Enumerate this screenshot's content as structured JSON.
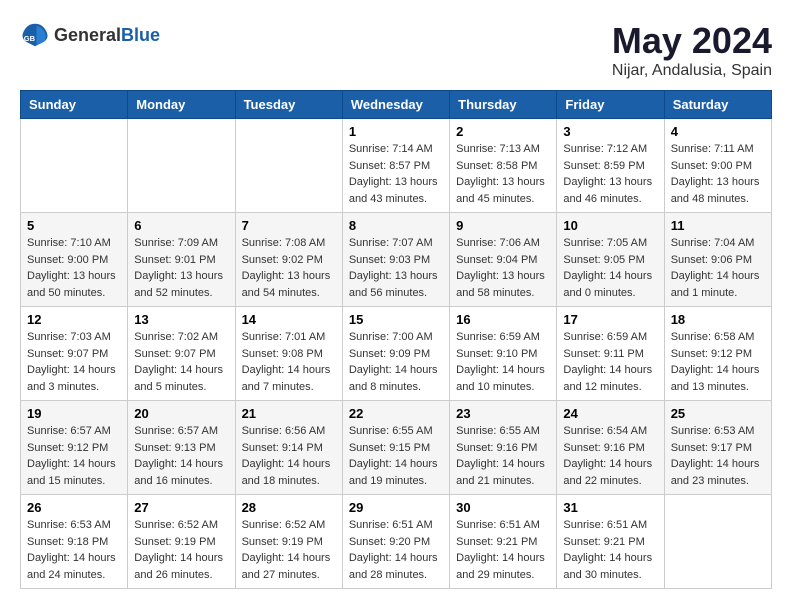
{
  "header": {
    "logo_general": "General",
    "logo_blue": "Blue",
    "month": "May 2024",
    "location": "Nijar, Andalusia, Spain"
  },
  "weekdays": [
    "Sunday",
    "Monday",
    "Tuesday",
    "Wednesday",
    "Thursday",
    "Friday",
    "Saturday"
  ],
  "weeks": [
    [
      {
        "day": "",
        "sunrise": "",
        "sunset": "",
        "daylight": ""
      },
      {
        "day": "",
        "sunrise": "",
        "sunset": "",
        "daylight": ""
      },
      {
        "day": "",
        "sunrise": "",
        "sunset": "",
        "daylight": ""
      },
      {
        "day": "1",
        "sunrise": "Sunrise: 7:14 AM",
        "sunset": "Sunset: 8:57 PM",
        "daylight": "Daylight: 13 hours and 43 minutes."
      },
      {
        "day": "2",
        "sunrise": "Sunrise: 7:13 AM",
        "sunset": "Sunset: 8:58 PM",
        "daylight": "Daylight: 13 hours and 45 minutes."
      },
      {
        "day": "3",
        "sunrise": "Sunrise: 7:12 AM",
        "sunset": "Sunset: 8:59 PM",
        "daylight": "Daylight: 13 hours and 46 minutes."
      },
      {
        "day": "4",
        "sunrise": "Sunrise: 7:11 AM",
        "sunset": "Sunset: 9:00 PM",
        "daylight": "Daylight: 13 hours and 48 minutes."
      }
    ],
    [
      {
        "day": "5",
        "sunrise": "Sunrise: 7:10 AM",
        "sunset": "Sunset: 9:00 PM",
        "daylight": "Daylight: 13 hours and 50 minutes."
      },
      {
        "day": "6",
        "sunrise": "Sunrise: 7:09 AM",
        "sunset": "Sunset: 9:01 PM",
        "daylight": "Daylight: 13 hours and 52 minutes."
      },
      {
        "day": "7",
        "sunrise": "Sunrise: 7:08 AM",
        "sunset": "Sunset: 9:02 PM",
        "daylight": "Daylight: 13 hours and 54 minutes."
      },
      {
        "day": "8",
        "sunrise": "Sunrise: 7:07 AM",
        "sunset": "Sunset: 9:03 PM",
        "daylight": "Daylight: 13 hours and 56 minutes."
      },
      {
        "day": "9",
        "sunrise": "Sunrise: 7:06 AM",
        "sunset": "Sunset: 9:04 PM",
        "daylight": "Daylight: 13 hours and 58 minutes."
      },
      {
        "day": "10",
        "sunrise": "Sunrise: 7:05 AM",
        "sunset": "Sunset: 9:05 PM",
        "daylight": "Daylight: 14 hours and 0 minutes."
      },
      {
        "day": "11",
        "sunrise": "Sunrise: 7:04 AM",
        "sunset": "Sunset: 9:06 PM",
        "daylight": "Daylight: 14 hours and 1 minute."
      }
    ],
    [
      {
        "day": "12",
        "sunrise": "Sunrise: 7:03 AM",
        "sunset": "Sunset: 9:07 PM",
        "daylight": "Daylight: 14 hours and 3 minutes."
      },
      {
        "day": "13",
        "sunrise": "Sunrise: 7:02 AM",
        "sunset": "Sunset: 9:07 PM",
        "daylight": "Daylight: 14 hours and 5 minutes."
      },
      {
        "day": "14",
        "sunrise": "Sunrise: 7:01 AM",
        "sunset": "Sunset: 9:08 PM",
        "daylight": "Daylight: 14 hours and 7 minutes."
      },
      {
        "day": "15",
        "sunrise": "Sunrise: 7:00 AM",
        "sunset": "Sunset: 9:09 PM",
        "daylight": "Daylight: 14 hours and 8 minutes."
      },
      {
        "day": "16",
        "sunrise": "Sunrise: 6:59 AM",
        "sunset": "Sunset: 9:10 PM",
        "daylight": "Daylight: 14 hours and 10 minutes."
      },
      {
        "day": "17",
        "sunrise": "Sunrise: 6:59 AM",
        "sunset": "Sunset: 9:11 PM",
        "daylight": "Daylight: 14 hours and 12 minutes."
      },
      {
        "day": "18",
        "sunrise": "Sunrise: 6:58 AM",
        "sunset": "Sunset: 9:12 PM",
        "daylight": "Daylight: 14 hours and 13 minutes."
      }
    ],
    [
      {
        "day": "19",
        "sunrise": "Sunrise: 6:57 AM",
        "sunset": "Sunset: 9:12 PM",
        "daylight": "Daylight: 14 hours and 15 minutes."
      },
      {
        "day": "20",
        "sunrise": "Sunrise: 6:57 AM",
        "sunset": "Sunset: 9:13 PM",
        "daylight": "Daylight: 14 hours and 16 minutes."
      },
      {
        "day": "21",
        "sunrise": "Sunrise: 6:56 AM",
        "sunset": "Sunset: 9:14 PM",
        "daylight": "Daylight: 14 hours and 18 minutes."
      },
      {
        "day": "22",
        "sunrise": "Sunrise: 6:55 AM",
        "sunset": "Sunset: 9:15 PM",
        "daylight": "Daylight: 14 hours and 19 minutes."
      },
      {
        "day": "23",
        "sunrise": "Sunrise: 6:55 AM",
        "sunset": "Sunset: 9:16 PM",
        "daylight": "Daylight: 14 hours and 21 minutes."
      },
      {
        "day": "24",
        "sunrise": "Sunrise: 6:54 AM",
        "sunset": "Sunset: 9:16 PM",
        "daylight": "Daylight: 14 hours and 22 minutes."
      },
      {
        "day": "25",
        "sunrise": "Sunrise: 6:53 AM",
        "sunset": "Sunset: 9:17 PM",
        "daylight": "Daylight: 14 hours and 23 minutes."
      }
    ],
    [
      {
        "day": "26",
        "sunrise": "Sunrise: 6:53 AM",
        "sunset": "Sunset: 9:18 PM",
        "daylight": "Daylight: 14 hours and 24 minutes."
      },
      {
        "day": "27",
        "sunrise": "Sunrise: 6:52 AM",
        "sunset": "Sunset: 9:19 PM",
        "daylight": "Daylight: 14 hours and 26 minutes."
      },
      {
        "day": "28",
        "sunrise": "Sunrise: 6:52 AM",
        "sunset": "Sunset: 9:19 PM",
        "daylight": "Daylight: 14 hours and 27 minutes."
      },
      {
        "day": "29",
        "sunrise": "Sunrise: 6:51 AM",
        "sunset": "Sunset: 9:20 PM",
        "daylight": "Daylight: 14 hours and 28 minutes."
      },
      {
        "day": "30",
        "sunrise": "Sunrise: 6:51 AM",
        "sunset": "Sunset: 9:21 PM",
        "daylight": "Daylight: 14 hours and 29 minutes."
      },
      {
        "day": "31",
        "sunrise": "Sunrise: 6:51 AM",
        "sunset": "Sunset: 9:21 PM",
        "daylight": "Daylight: 14 hours and 30 minutes."
      },
      {
        "day": "",
        "sunrise": "",
        "sunset": "",
        "daylight": ""
      }
    ]
  ]
}
